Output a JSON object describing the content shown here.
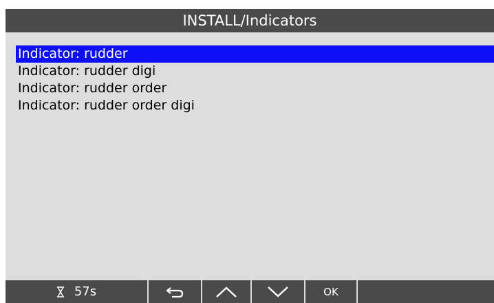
{
  "header": {
    "title": "INSTALL/Indicators"
  },
  "menu": {
    "items": [
      {
        "label": "Indicator: rudder",
        "selected": true
      },
      {
        "label": "Indicator: rudder digi",
        "selected": false
      },
      {
        "label": "Indicator: rudder order",
        "selected": false
      },
      {
        "label": "Indicator: rudder order digi",
        "selected": false
      }
    ]
  },
  "footer": {
    "timer_icon": "hourglass-icon",
    "timer_value": "57s",
    "back_icon": "back-arrow-icon",
    "up_icon": "chevron-up-icon",
    "down_icon": "chevron-down-icon",
    "ok_label": "OK"
  },
  "colors": {
    "bar_background": "#4a4a4a",
    "screen_background": "#dddddd",
    "selection": "#0f0ff5"
  }
}
